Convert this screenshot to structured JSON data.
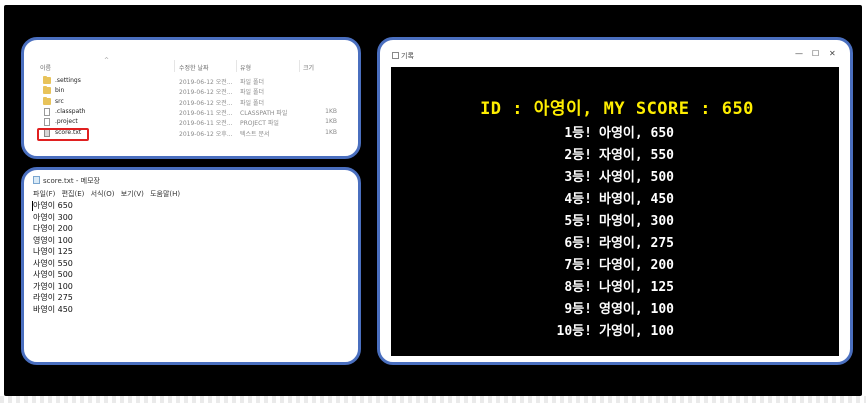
{
  "explorer": {
    "columns": {
      "name": "이름",
      "date": "수정한 날짜",
      "type": "유형",
      "size": "크기"
    },
    "files": [
      {
        "icon": "folder-icon",
        "name": ".settings",
        "date": "2019-06-12 오전...",
        "type": "파일 폴더",
        "size": ""
      },
      {
        "icon": "folder-icon",
        "name": "bin",
        "date": "2019-06-12 오전...",
        "type": "파일 폴더",
        "size": ""
      },
      {
        "icon": "folder-icon",
        "name": "src",
        "date": "2019-06-12 오전...",
        "type": "파일 폴더",
        "size": ""
      },
      {
        "icon": "file-icon",
        "name": ".classpath",
        "date": "2019-06-11 오전...",
        "type": "CLASSPATH 파일",
        "size": "1KB"
      },
      {
        "icon": "file-icon",
        "name": ".project",
        "date": "2019-06-11 오전...",
        "type": "PROJECT 파일",
        "size": "1KB"
      },
      {
        "icon": "text-file-icon",
        "name": "score.txt",
        "date": "2019-06-12 오후...",
        "type": "텍스트 문서",
        "size": "1KB"
      }
    ]
  },
  "notepad": {
    "title": "score.txt - 메모장",
    "menu": [
      "파일(F)",
      "편집(E)",
      "서식(O)",
      "보기(V)",
      "도움말(H)"
    ],
    "lines": [
      "아영이 650",
      "아영이 300",
      "다영이 200",
      "영영이 100",
      "나영이 125",
      "사영이 550",
      "사영이 500",
      "가영이 100",
      "라영이 275",
      "바영이 450"
    ]
  },
  "game_window": {
    "title": "기록",
    "controls": {
      "minimize": "—",
      "maximize": "☐",
      "close": "✕"
    },
    "header": "ID : 아영이, MY SCORE : 650",
    "rankings": [
      {
        "rank": "1등!",
        "entry": "아영이, 650"
      },
      {
        "rank": "2등!",
        "entry": "자영이, 550"
      },
      {
        "rank": "3등!",
        "entry": "사영이, 500"
      },
      {
        "rank": "4등!",
        "entry": "바영이, 450"
      },
      {
        "rank": "5등!",
        "entry": "마영이, 300"
      },
      {
        "rank": "6등!",
        "entry": "라영이, 275"
      },
      {
        "rank": "7등!",
        "entry": "다영이, 200"
      },
      {
        "rank": "8등!",
        "entry": "나영이, 125"
      },
      {
        "rank": "9등!",
        "entry": " 영영이, 100"
      },
      {
        "rank": "10등!",
        "entry": " 가영이, 100"
      }
    ]
  },
  "colors": {
    "frame": "#4a6fbf",
    "highlight": "#e02020",
    "score_header": "#ffee00",
    "screen_bg": "#000000"
  }
}
